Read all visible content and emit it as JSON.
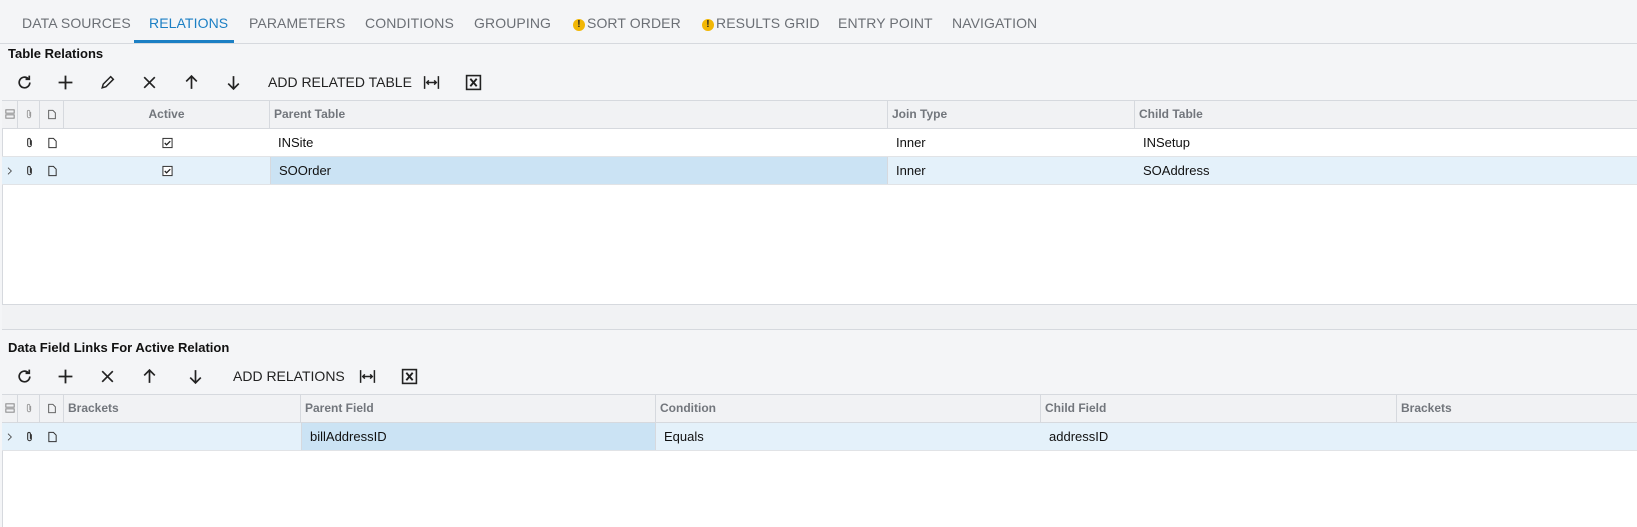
{
  "tabs": [
    {
      "label": "DATA SOURCES",
      "warning": false
    },
    {
      "label": "RELATIONS",
      "warning": false,
      "active": true
    },
    {
      "label": "PARAMETERS",
      "warning": false
    },
    {
      "label": "CONDITIONS",
      "warning": false
    },
    {
      "label": "GROUPING",
      "warning": false
    },
    {
      "label": "SORT ORDER",
      "warning": true
    },
    {
      "label": "RESULTS GRID",
      "warning": true
    },
    {
      "label": "ENTRY POINT",
      "warning": false
    },
    {
      "label": "NAVIGATION",
      "warning": false
    }
  ],
  "warning_glyph": "!",
  "relations": {
    "title": "Table Relations",
    "toolbar": {
      "refresh_icon": "refresh-icon",
      "add_icon": "plus-icon",
      "edit_icon": "pencil-icon",
      "delete_icon": "close-icon",
      "up_icon": "arrow-up-icon",
      "down_icon": "arrow-down-icon",
      "add_related_table": "ADD RELATED TABLE",
      "fit_icon": "fit-columns-icon",
      "excel_icon": "excel-export-icon"
    },
    "columns": {
      "active": "Active",
      "parent_table": "Parent Table",
      "join_type": "Join Type",
      "child_table": "Child Table"
    },
    "rows": [
      {
        "active": true,
        "parent_table": "INSite",
        "join_type": "Inner",
        "child_table": "INSetup",
        "selected": false
      },
      {
        "active": true,
        "parent_table": "SOOrder",
        "join_type": "Inner",
        "child_table": "SOAddress",
        "selected": true
      }
    ]
  },
  "links": {
    "title": "Data Field Links For Active Relation",
    "toolbar": {
      "refresh_icon": "refresh-icon",
      "add_icon": "plus-icon",
      "delete_icon": "close-icon",
      "up_icon": "arrow-up-icon",
      "down_icon": "arrow-down-icon",
      "add_relations": "ADD RELATIONS",
      "fit_icon": "fit-columns-icon",
      "excel_icon": "excel-export-icon"
    },
    "columns": {
      "open_brackets": "Brackets",
      "parent_field": "Parent Field",
      "condition": "Condition",
      "child_field": "Child Field",
      "close_brackets": "Brackets"
    },
    "rows": [
      {
        "open_brackets": "",
        "parent_field": "billAddressID",
        "condition": "Equals",
        "child_field": "addressID",
        "close_brackets": "",
        "selected": true
      }
    ]
  },
  "colors": {
    "accent": "#1b7fc4",
    "warning": "#f2b705",
    "selected_row": "#e4f1fa",
    "active_cell": "#cbe3f4"
  }
}
